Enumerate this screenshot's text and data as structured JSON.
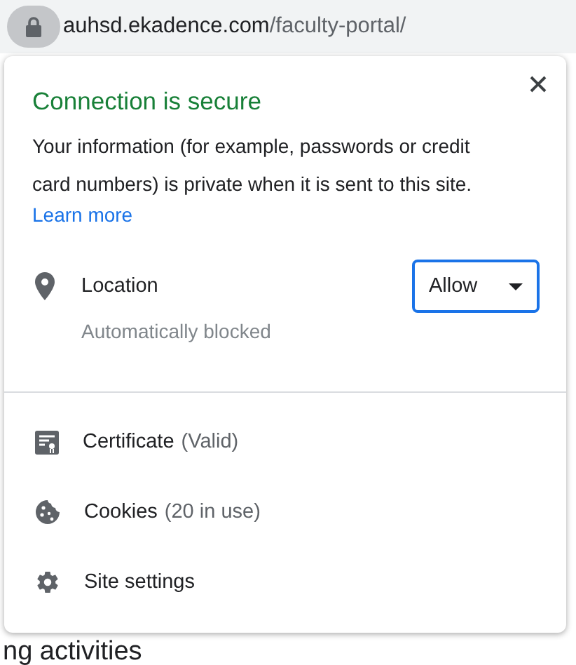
{
  "address_bar": {
    "host": "auhsd.ekadence.com",
    "path": "/faculty-portal/"
  },
  "background": {
    "heading": "ng activities"
  },
  "popup": {
    "title": "Connection is secure",
    "description": "Your information (for example, passwords or credit card numbers) is private when it is sent to this site.",
    "learn_more": "Learn more",
    "permissions": [
      {
        "kind": "location",
        "label": "Location",
        "status": "Automatically blocked",
        "value": "Allow"
      }
    ],
    "items": [
      {
        "kind": "certificate",
        "label": "Certificate",
        "detail": "(Valid)"
      },
      {
        "kind": "cookies",
        "label": "Cookies",
        "detail": "(20 in use)"
      },
      {
        "kind": "settings",
        "label": "Site settings"
      }
    ]
  }
}
